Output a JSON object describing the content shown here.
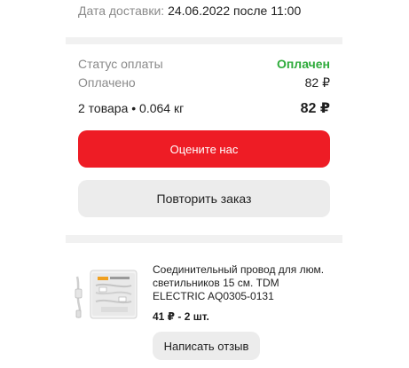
{
  "delivery": {
    "label": "Дата доставки:",
    "value": "24.06.2022 после 11:00"
  },
  "payment": {
    "status_label": "Статус оплаты",
    "status_value": "Оплачен",
    "paid_label": "Оплачено",
    "paid_value": "82 ₽",
    "summary_label": "2 товара • 0.064 кг",
    "total_value": "82 ₽"
  },
  "actions": {
    "rate_label": "Оцените нас",
    "repeat_label": "Повторить заказ"
  },
  "item": {
    "title": "Соединительный провод для люм. светильников 15 см. TDM ELECTRIC AQ0305-0131",
    "price": "41 ₽ - 2 шт.",
    "review_label": "Написать отзыв",
    "thumb_icon": "cable-package-image"
  },
  "colors": {
    "accent": "#ee1c25",
    "paid_status": "#2eab3b",
    "muted_text": "#8a8a8a",
    "secondary_button": "#ececec"
  }
}
